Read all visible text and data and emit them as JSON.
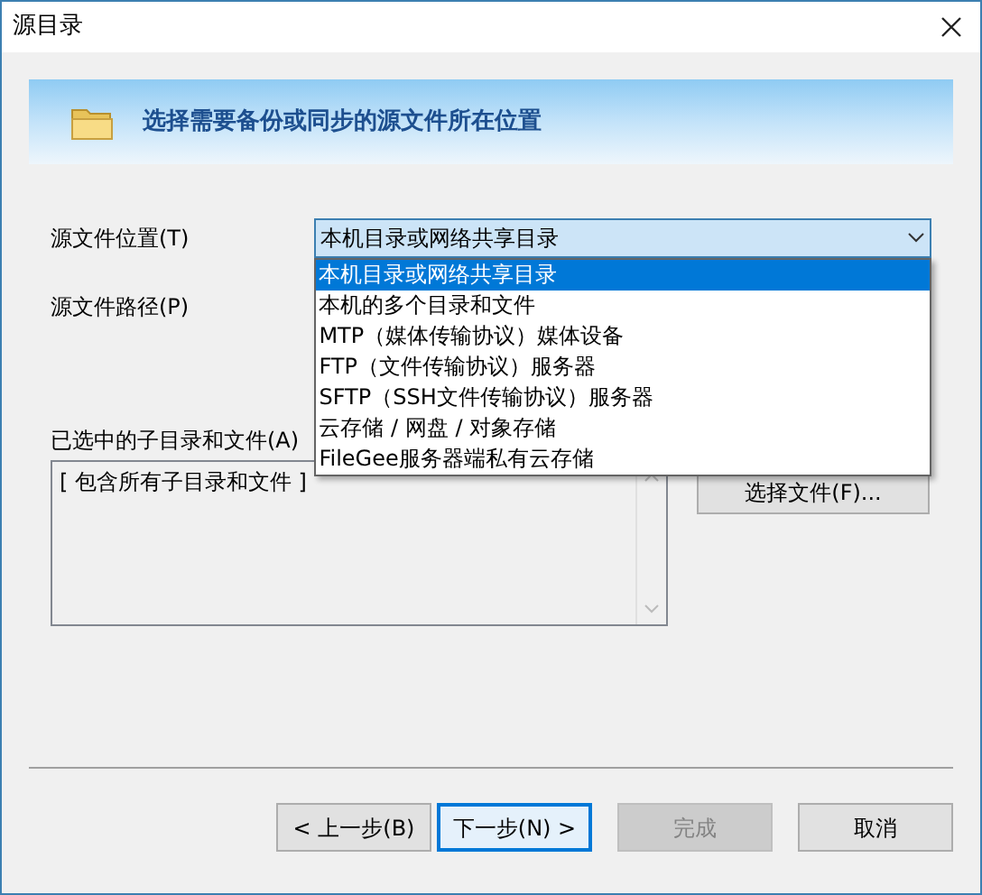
{
  "window": {
    "title": "源目录"
  },
  "banner": {
    "heading": "选择需要备份或同步的源文件所在位置"
  },
  "source_location": {
    "label": "源文件位置(T)",
    "value": "本机目录或网络共享目录",
    "expanded": true,
    "options": [
      {
        "label": "本机目录或网络共享目录",
        "selected": true
      },
      {
        "label": "本机的多个目录和文件",
        "selected": false
      },
      {
        "label": "MTP（媒体传输协议）媒体设备",
        "selected": false
      },
      {
        "label": "FTP（文件传输协议）服务器",
        "selected": false
      },
      {
        "label": "SFTP（SSH文件传输协议）服务器",
        "selected": false
      },
      {
        "label": "云存储 / 网盘 / 对象存储",
        "selected": false
      },
      {
        "label": "FileGee服务器端私有云存储",
        "selected": false
      }
    ]
  },
  "source_path": {
    "label": "源文件路径(P)"
  },
  "selected_items": {
    "label": "已选中的子目录和文件(A)",
    "items": [
      "[ 包含所有子目录和文件 ]"
    ]
  },
  "choose_file_button": "选择文件(F)...",
  "buttons": [
    {
      "label": "< 上一步(B)",
      "disabled": false,
      "focused": false
    },
    {
      "label": "下一步(N) >",
      "disabled": false,
      "focused": true
    },
    {
      "label": "完成",
      "disabled": true,
      "focused": false
    },
    {
      "label": "取消",
      "disabled": false,
      "focused": false
    }
  ]
}
